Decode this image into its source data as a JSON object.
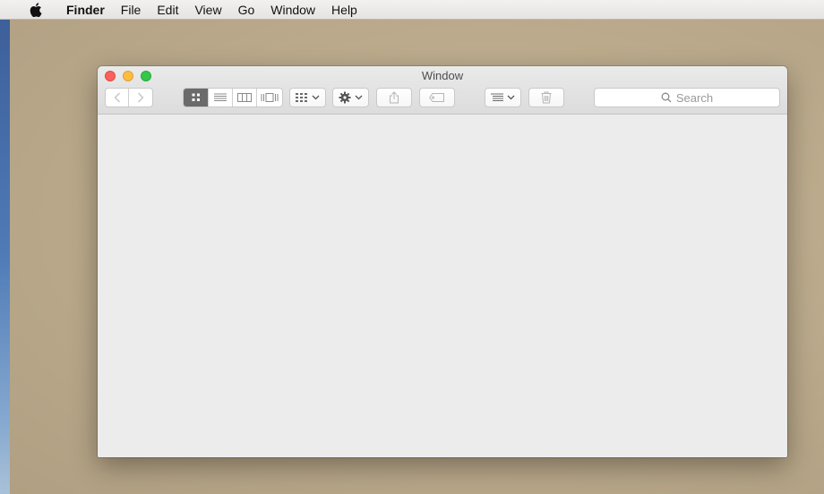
{
  "menubar": {
    "apple_icon": "apple-icon",
    "items": [
      {
        "label": "Finder",
        "bold": true
      },
      {
        "label": "File"
      },
      {
        "label": "Edit"
      },
      {
        "label": "View"
      },
      {
        "label": "Go"
      },
      {
        "label": "Window"
      },
      {
        "label": "Help"
      }
    ]
  },
  "window": {
    "title": "Window",
    "traffic_lights": {
      "close": "#fc605c",
      "minimize": "#fdbc40",
      "zoom": "#34c84a"
    },
    "toolbar": {
      "nav": [
        "back-icon",
        "forward-icon"
      ],
      "view_modes": [
        "icon-view-icon",
        "list-view-icon",
        "column-view-icon",
        "cover-flow-icon"
      ],
      "active_view": "icon-view",
      "arrange_icon": "arrange-grid-icon",
      "action_icon": "gear-icon",
      "share_icon": "share-icon",
      "tag_icon": "tag-icon",
      "sort_icon": "list-sort-icon",
      "trash_icon": "trash-icon",
      "search": {
        "placeholder": "Search"
      }
    }
  }
}
